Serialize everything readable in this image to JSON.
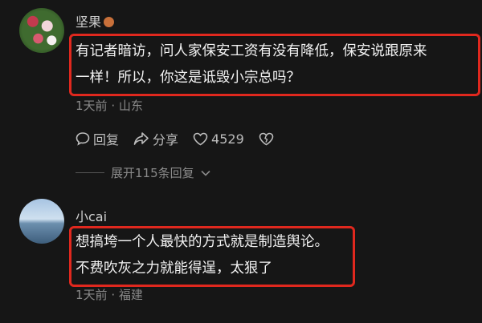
{
  "comments": [
    {
      "username": "坚果",
      "text_lines": [
        "有记者暗访，问人家保安工资有没有降低，保安说跟原来",
        "一样！所以，你这是诋毁小宗总吗？"
      ],
      "time": "1天前",
      "location": "山东",
      "separator": "·",
      "actions": {
        "reply": "回复",
        "share": "分享",
        "likes": "4529"
      },
      "expand_label": "展开115条回复"
    },
    {
      "username": "小cai",
      "text_lines": [
        "想搞垮一个人最快的方式就是制造舆论。",
        "不费吹灰之力就能得逞，太狠了"
      ],
      "time": "1天前",
      "location": "福建",
      "separator": "·"
    }
  ],
  "colors": {
    "background": "#161616",
    "highlight": "#e0281e",
    "muted": "#8a8a8a"
  },
  "icons": [
    "reply-icon",
    "share-icon",
    "heart-icon",
    "broken-heart-icon",
    "chevron-down-icon"
  ]
}
